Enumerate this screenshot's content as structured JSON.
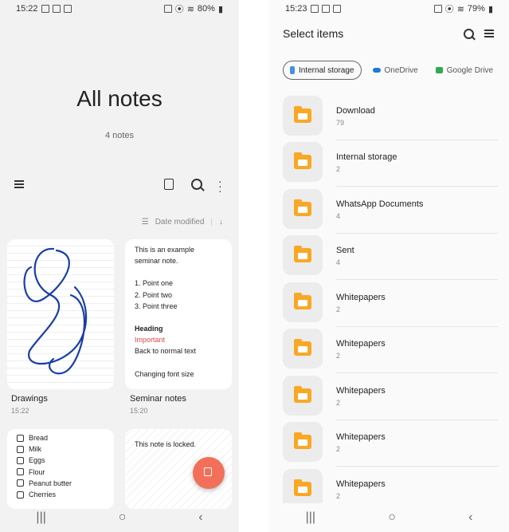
{
  "left_screen": {
    "status": {
      "time": "15:22",
      "battery": "80%"
    },
    "title": "All notes",
    "subtitle": "4 notes",
    "sort_label": "Date modified",
    "notes": [
      {
        "title": "Drawings",
        "time": "15:22"
      },
      {
        "title": "Seminar notes",
        "time": "15:20",
        "lines": [
          "This is an example",
          "seminar note.",
          "",
          "1.   Point one",
          "2.   Point two",
          "3.   Point three",
          "",
          "Heading",
          "Important",
          "Back to normal text",
          "",
          "Changing font size"
        ]
      },
      {
        "checklist": [
          "Bread",
          "Milk",
          "Eggs",
          "Flour",
          "Peanut butter",
          "Cherries"
        ]
      },
      {
        "locked_text": "This note is locked."
      }
    ]
  },
  "right_screen": {
    "status": {
      "time": "15:23",
      "battery": "79%"
    },
    "header": "Select items",
    "tabs": [
      {
        "label": "Internal storage",
        "color": "#4a90e2"
      },
      {
        "label": "OneDrive",
        "color": "#1f7ad8"
      },
      {
        "label": "Google Drive",
        "color": "#34a853"
      }
    ],
    "folders": [
      {
        "name": "Download",
        "count": "79"
      },
      {
        "name": "Internal storage",
        "count": "2"
      },
      {
        "name": "WhatsApp Documents",
        "count": "4"
      },
      {
        "name": "Sent",
        "count": "4"
      },
      {
        "name": "Whitepapers",
        "count": "2"
      },
      {
        "name": "Whitepapers",
        "count": "2"
      },
      {
        "name": "Whitepapers",
        "count": "2"
      },
      {
        "name": "Whitepapers",
        "count": "2"
      },
      {
        "name": "Whitepapers",
        "count": "2"
      }
    ]
  },
  "nav": {
    "recent": "|||",
    "home": "○",
    "back": "‹"
  },
  "colors": {
    "accent_fab": "#f2705a",
    "folder": "#f9a825",
    "important": "#e0464a"
  }
}
